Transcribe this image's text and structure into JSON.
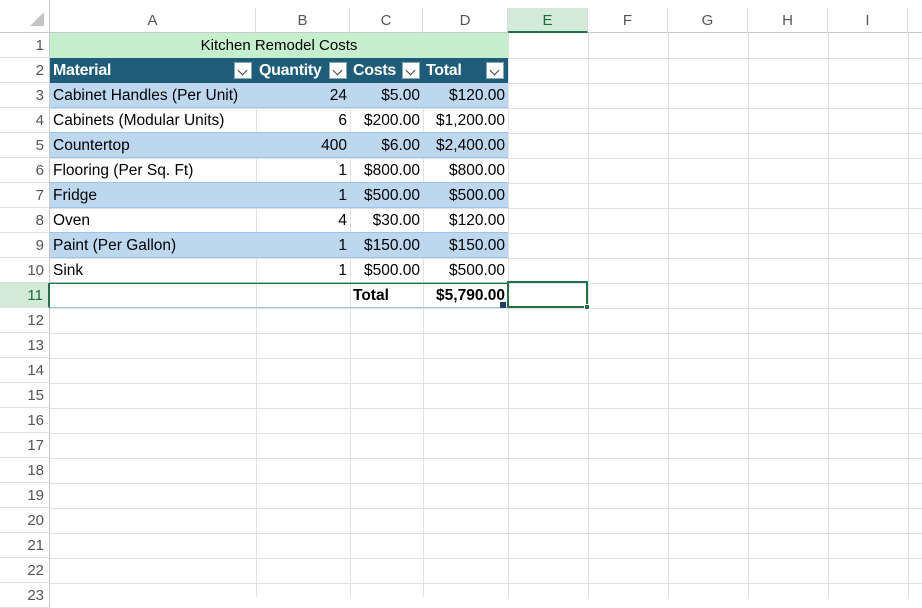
{
  "columns": [
    "A",
    "B",
    "C",
    "D",
    "E",
    "F",
    "G",
    "H",
    "I"
  ],
  "selected_column": "E",
  "rows": [
    "1",
    "2",
    "3",
    "4",
    "5",
    "6",
    "7",
    "8",
    "9",
    "10",
    "11",
    "12",
    "13",
    "14",
    "15",
    "16",
    "17",
    "18",
    "19",
    "20",
    "21",
    "22",
    "23"
  ],
  "selected_row": "11",
  "table": {
    "title": "Kitchen Remodel Costs",
    "headers": [
      "Material",
      "Quantity",
      "Costs",
      "Total"
    ],
    "body": [
      [
        "Cabinet Handles (Per Unit)",
        "24",
        "$5.00",
        "$120.00"
      ],
      [
        "Cabinets (Modular Units)",
        "6",
        "$200.00",
        "$1,200.00"
      ],
      [
        "Countertop",
        "400",
        "$6.00",
        "$2,400.00"
      ],
      [
        "Flooring (Per Sq. Ft)",
        "1",
        "$800.00",
        "$800.00"
      ],
      [
        "Fridge",
        "1",
        "$500.00",
        "$500.00"
      ],
      [
        "Oven",
        "4",
        "$30.00",
        "$120.00"
      ],
      [
        "Paint (Per Gallon)",
        "1",
        "$150.00",
        "$150.00"
      ],
      [
        "Sink",
        "1",
        "$500.00",
        "$500.00"
      ]
    ],
    "total_label": "Total",
    "total_value": "$5,790.00"
  },
  "colors": {
    "header_fill": "#1f5c7a",
    "band_fill": "#bdd7ee",
    "title_fill": "#c6efce",
    "selection": "#217346"
  }
}
